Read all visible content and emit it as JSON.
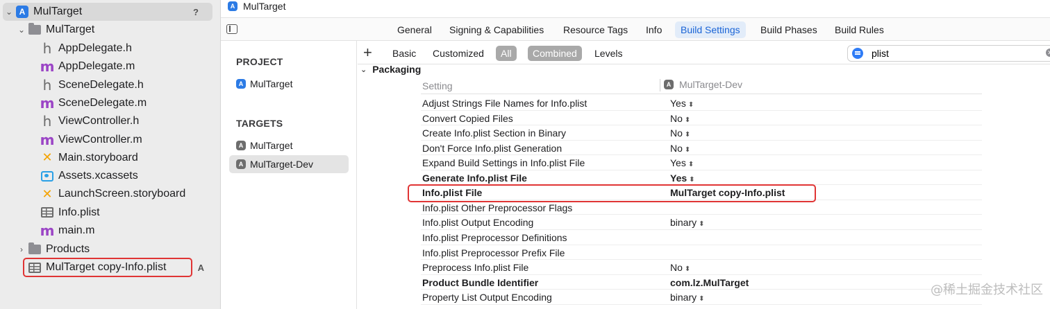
{
  "navigator": {
    "root": {
      "label": "MulTarget",
      "badge": "?"
    },
    "group": {
      "label": "MulTarget"
    },
    "files": [
      {
        "label": "AppDelegate.h",
        "icon": "h-file-icon",
        "glyph": "h"
      },
      {
        "label": "AppDelegate.m",
        "icon": "m-file-icon",
        "glyph": "m"
      },
      {
        "label": "SceneDelegate.h",
        "icon": "h-file-icon",
        "glyph": "h"
      },
      {
        "label": "SceneDelegate.m",
        "icon": "m-file-icon",
        "glyph": "m"
      },
      {
        "label": "ViewController.h",
        "icon": "h-file-icon",
        "glyph": "h"
      },
      {
        "label": "ViewController.m",
        "icon": "m-file-icon",
        "glyph": "m"
      },
      {
        "label": "Main.storyboard",
        "icon": "storyboard-icon",
        "glyph": "✕"
      },
      {
        "label": "Assets.xcassets",
        "icon": "assets-icon",
        "glyph": ""
      },
      {
        "label": "LaunchScreen.storyboard",
        "icon": "storyboard-icon",
        "glyph": "✕"
      },
      {
        "label": "Info.plist",
        "icon": "plist-icon",
        "glyph": ""
      },
      {
        "label": "main.m",
        "icon": "m-file-icon",
        "glyph": "m"
      }
    ],
    "products": {
      "label": "Products"
    },
    "new_file": {
      "label": "MulTarget copy-Info.plist",
      "badge": "A"
    }
  },
  "editor": {
    "breadcrumb": "MulTarget",
    "tabs": [
      "General",
      "Signing & Capabilities",
      "Resource Tags",
      "Info",
      "Build Settings",
      "Build Phases",
      "Build Rules"
    ],
    "active_tab": "Build Settings"
  },
  "targets_list": {
    "project_header": "PROJECT",
    "project_item": "MulTarget",
    "targets_header": "TARGETS",
    "targets": [
      "MulTarget",
      "MulTarget-Dev"
    ],
    "selected_target": "MulTarget-Dev"
  },
  "filter_bar": {
    "plus": "+",
    "basic": "Basic",
    "customized": "Customized",
    "all": "All",
    "combined": "Combined",
    "levels": "Levels",
    "search_value": "plist"
  },
  "settings": {
    "group": "Packaging",
    "column_setting": "Setting",
    "column_target": "MulTarget-Dev",
    "rows": [
      {
        "name": "Adjust Strings File Names for Info.plist",
        "value": "Yes",
        "stepper": true,
        "bold": false
      },
      {
        "name": "Convert Copied Files",
        "value": "No",
        "stepper": true,
        "bold": false
      },
      {
        "name": "Create Info.plist Section in Binary",
        "value": "No",
        "stepper": true,
        "bold": false
      },
      {
        "name": "Don't Force Info.plist Generation",
        "value": "No",
        "stepper": true,
        "bold": false
      },
      {
        "name": "Expand Build Settings in Info.plist File",
        "value": "Yes",
        "stepper": true,
        "bold": false
      },
      {
        "name": "Generate Info.plist File",
        "value": "Yes",
        "stepper": true,
        "bold": true
      },
      {
        "name": "Info.plist File",
        "value": "MulTarget copy-Info.plist",
        "stepper": false,
        "bold": true
      },
      {
        "name": "Info.plist Other Preprocessor Flags",
        "value": "",
        "stepper": false,
        "bold": false
      },
      {
        "name": "Info.plist Output Encoding",
        "value": "binary",
        "stepper": true,
        "bold": false
      },
      {
        "name": "Info.plist Preprocessor Definitions",
        "value": "",
        "stepper": false,
        "bold": false
      },
      {
        "name": "Info.plist Preprocessor Prefix File",
        "value": "",
        "stepper": false,
        "bold": false
      },
      {
        "name": "Preprocess Info.plist File",
        "value": "No",
        "stepper": true,
        "bold": false
      },
      {
        "name": "Product Bundle Identifier",
        "value": "com.lz.MulTarget",
        "stepper": false,
        "bold": true
      },
      {
        "name": "Property List Output Encoding",
        "value": "binary",
        "stepper": true,
        "bold": false
      }
    ]
  },
  "watermark": "@稀土掘金技术社区",
  "colors": {
    "accent": "#1a64d6",
    "highlight": "#e03434",
    "selected_filter": "#a9a9a9"
  }
}
